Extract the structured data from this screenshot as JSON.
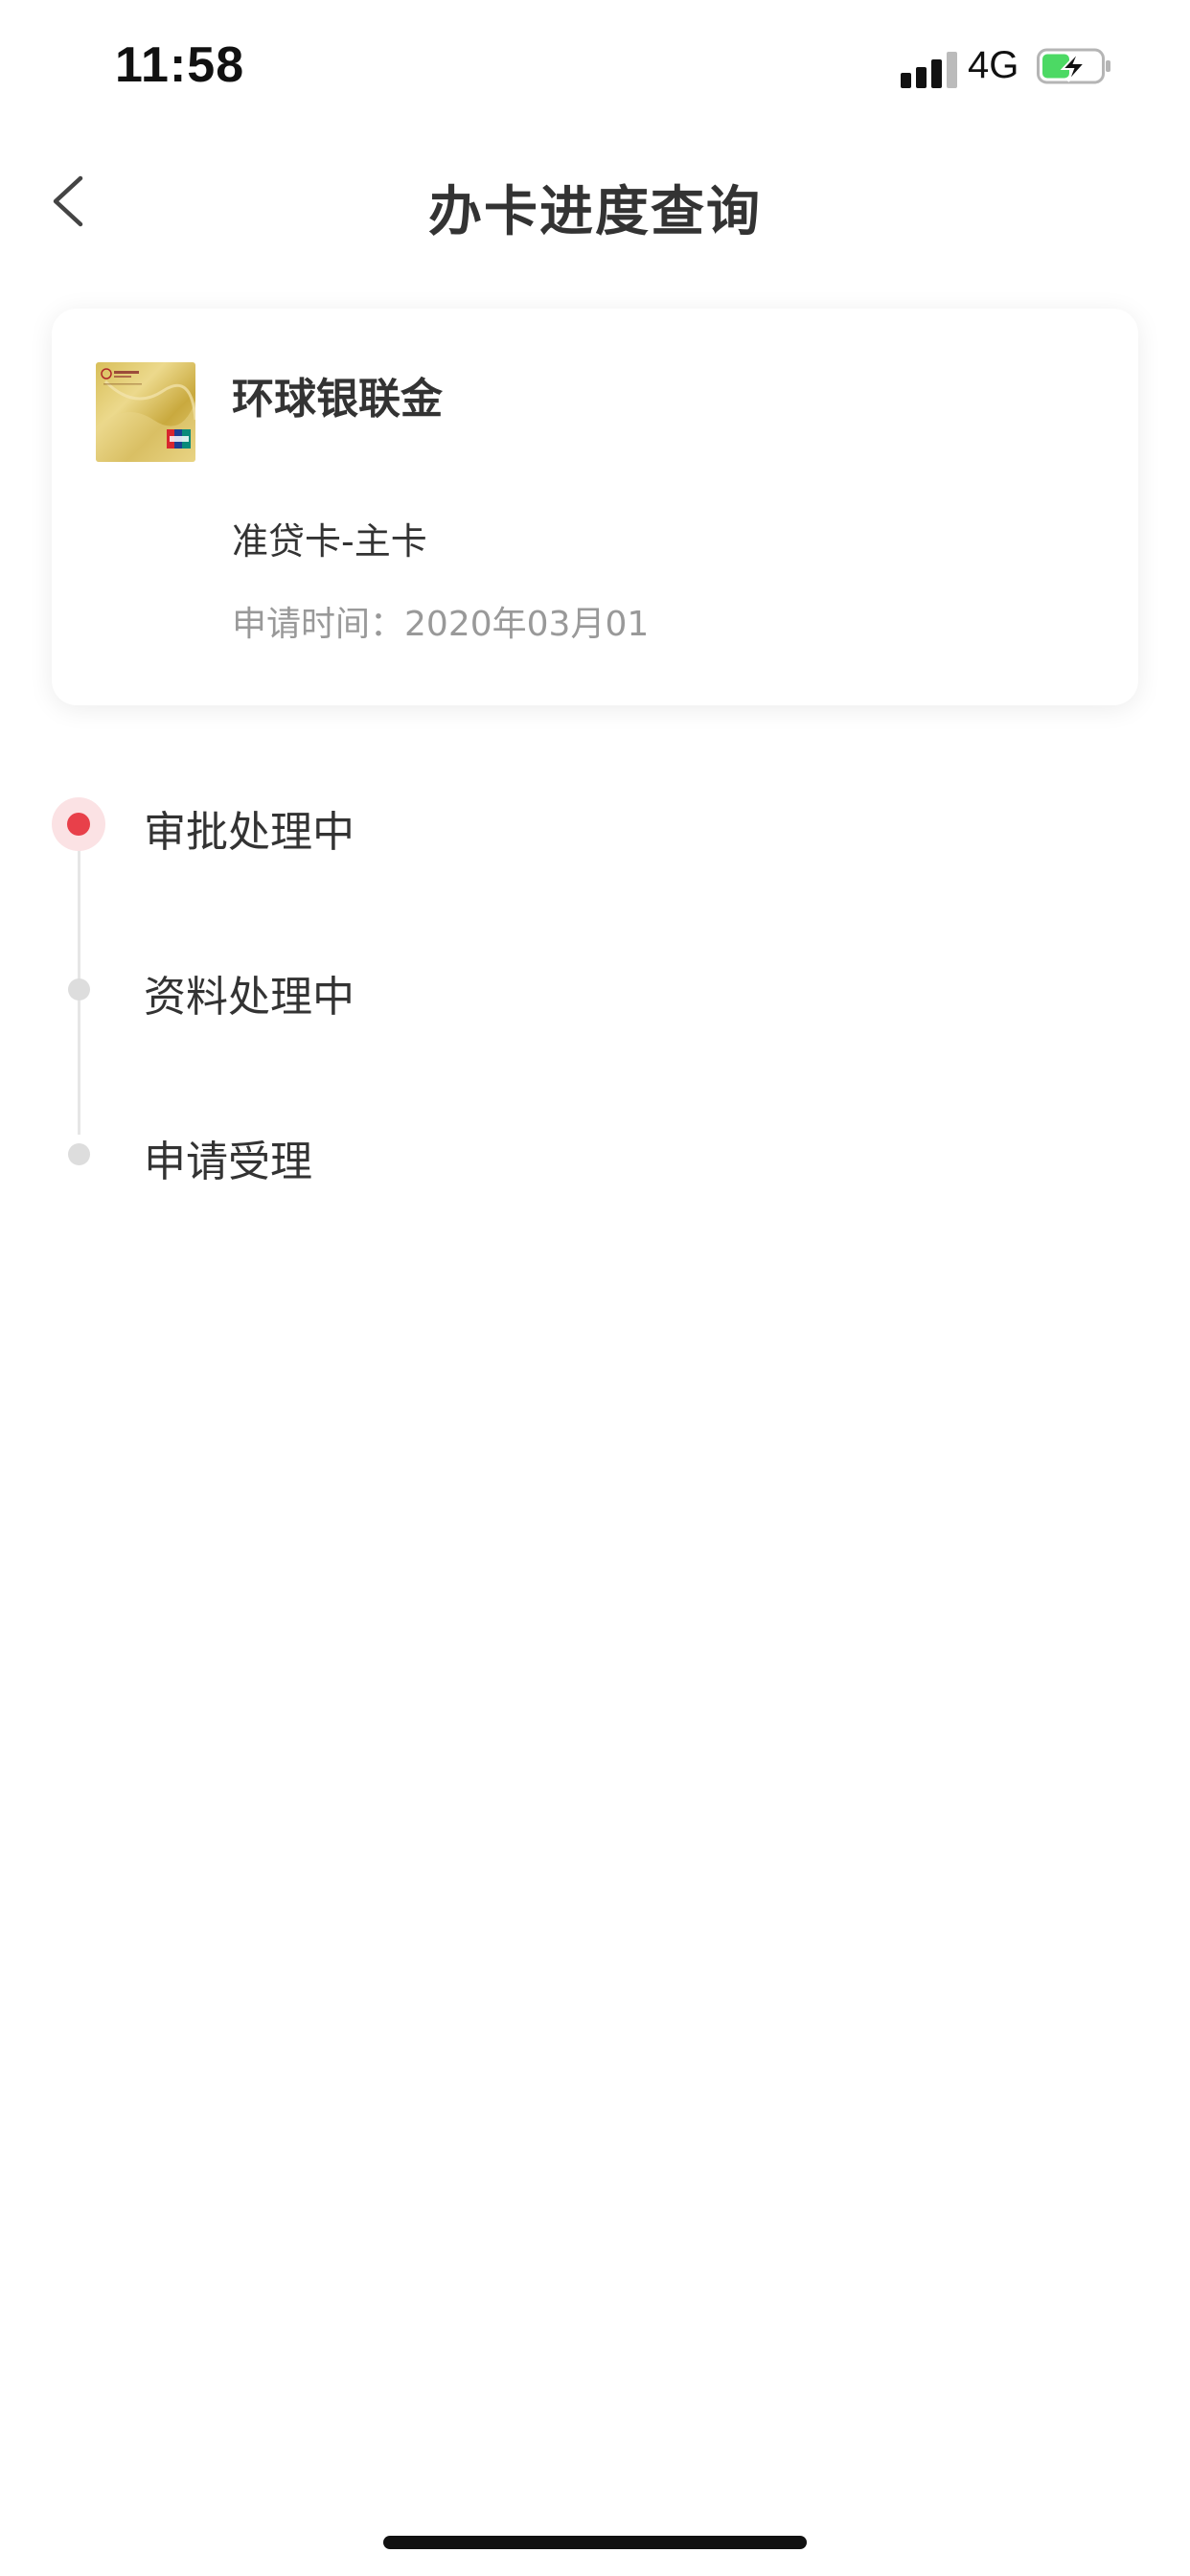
{
  "status_bar": {
    "time": "11:58",
    "network": "4G",
    "signal_icon": "signal-bars-icon",
    "battery_icon": "battery-charging-icon",
    "battery_level": 0.45
  },
  "header": {
    "title": "办卡进度查询",
    "back_icon": "chevron-left-icon"
  },
  "card": {
    "name": "环球银联金",
    "type": "准贷卡-主卡",
    "date_label": "申请时间：",
    "date_value": "2020年03月01"
  },
  "timeline": {
    "items": [
      {
        "label": "审批处理中",
        "active": true
      },
      {
        "label": "资料处理中",
        "active": false
      },
      {
        "label": "申请受理",
        "active": false
      }
    ]
  },
  "colors": {
    "accent": "#e8404a",
    "text_primary": "#333333",
    "text_secondary": "#999999",
    "inactive_dot": "#dddddd"
  }
}
